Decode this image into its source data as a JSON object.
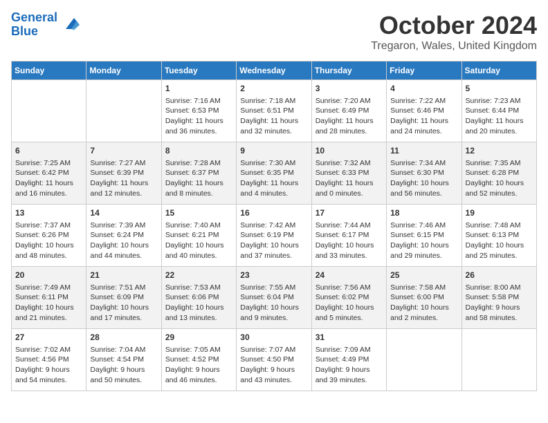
{
  "header": {
    "logo_line1": "General",
    "logo_line2": "Blue",
    "month_title": "October 2024",
    "location": "Tregaron, Wales, United Kingdom"
  },
  "days_of_week": [
    "Sunday",
    "Monday",
    "Tuesday",
    "Wednesday",
    "Thursday",
    "Friday",
    "Saturday"
  ],
  "weeks": [
    [
      {
        "day": "",
        "info": ""
      },
      {
        "day": "",
        "info": ""
      },
      {
        "day": "1",
        "info": "Sunrise: 7:16 AM\nSunset: 6:53 PM\nDaylight: 11 hours\nand 36 minutes."
      },
      {
        "day": "2",
        "info": "Sunrise: 7:18 AM\nSunset: 6:51 PM\nDaylight: 11 hours\nand 32 minutes."
      },
      {
        "day": "3",
        "info": "Sunrise: 7:20 AM\nSunset: 6:49 PM\nDaylight: 11 hours\nand 28 minutes."
      },
      {
        "day": "4",
        "info": "Sunrise: 7:22 AM\nSunset: 6:46 PM\nDaylight: 11 hours\nand 24 minutes."
      },
      {
        "day": "5",
        "info": "Sunrise: 7:23 AM\nSunset: 6:44 PM\nDaylight: 11 hours\nand 20 minutes."
      }
    ],
    [
      {
        "day": "6",
        "info": "Sunrise: 7:25 AM\nSunset: 6:42 PM\nDaylight: 11 hours\nand 16 minutes."
      },
      {
        "day": "7",
        "info": "Sunrise: 7:27 AM\nSunset: 6:39 PM\nDaylight: 11 hours\nand 12 minutes."
      },
      {
        "day": "8",
        "info": "Sunrise: 7:28 AM\nSunset: 6:37 PM\nDaylight: 11 hours\nand 8 minutes."
      },
      {
        "day": "9",
        "info": "Sunrise: 7:30 AM\nSunset: 6:35 PM\nDaylight: 11 hours\nand 4 minutes."
      },
      {
        "day": "10",
        "info": "Sunrise: 7:32 AM\nSunset: 6:33 PM\nDaylight: 11 hours\nand 0 minutes."
      },
      {
        "day": "11",
        "info": "Sunrise: 7:34 AM\nSunset: 6:30 PM\nDaylight: 10 hours\nand 56 minutes."
      },
      {
        "day": "12",
        "info": "Sunrise: 7:35 AM\nSunset: 6:28 PM\nDaylight: 10 hours\nand 52 minutes."
      }
    ],
    [
      {
        "day": "13",
        "info": "Sunrise: 7:37 AM\nSunset: 6:26 PM\nDaylight: 10 hours\nand 48 minutes."
      },
      {
        "day": "14",
        "info": "Sunrise: 7:39 AM\nSunset: 6:24 PM\nDaylight: 10 hours\nand 44 minutes."
      },
      {
        "day": "15",
        "info": "Sunrise: 7:40 AM\nSunset: 6:21 PM\nDaylight: 10 hours\nand 40 minutes."
      },
      {
        "day": "16",
        "info": "Sunrise: 7:42 AM\nSunset: 6:19 PM\nDaylight: 10 hours\nand 37 minutes."
      },
      {
        "day": "17",
        "info": "Sunrise: 7:44 AM\nSunset: 6:17 PM\nDaylight: 10 hours\nand 33 minutes."
      },
      {
        "day": "18",
        "info": "Sunrise: 7:46 AM\nSunset: 6:15 PM\nDaylight: 10 hours\nand 29 minutes."
      },
      {
        "day": "19",
        "info": "Sunrise: 7:48 AM\nSunset: 6:13 PM\nDaylight: 10 hours\nand 25 minutes."
      }
    ],
    [
      {
        "day": "20",
        "info": "Sunrise: 7:49 AM\nSunset: 6:11 PM\nDaylight: 10 hours\nand 21 minutes."
      },
      {
        "day": "21",
        "info": "Sunrise: 7:51 AM\nSunset: 6:09 PM\nDaylight: 10 hours\nand 17 minutes."
      },
      {
        "day": "22",
        "info": "Sunrise: 7:53 AM\nSunset: 6:06 PM\nDaylight: 10 hours\nand 13 minutes."
      },
      {
        "day": "23",
        "info": "Sunrise: 7:55 AM\nSunset: 6:04 PM\nDaylight: 10 hours\nand 9 minutes."
      },
      {
        "day": "24",
        "info": "Sunrise: 7:56 AM\nSunset: 6:02 PM\nDaylight: 10 hours\nand 5 minutes."
      },
      {
        "day": "25",
        "info": "Sunrise: 7:58 AM\nSunset: 6:00 PM\nDaylight: 10 hours\nand 2 minutes."
      },
      {
        "day": "26",
        "info": "Sunrise: 8:00 AM\nSunset: 5:58 PM\nDaylight: 9 hours\nand 58 minutes."
      }
    ],
    [
      {
        "day": "27",
        "info": "Sunrise: 7:02 AM\nSunset: 4:56 PM\nDaylight: 9 hours\nand 54 minutes."
      },
      {
        "day": "28",
        "info": "Sunrise: 7:04 AM\nSunset: 4:54 PM\nDaylight: 9 hours\nand 50 minutes."
      },
      {
        "day": "29",
        "info": "Sunrise: 7:05 AM\nSunset: 4:52 PM\nDaylight: 9 hours\nand 46 minutes."
      },
      {
        "day": "30",
        "info": "Sunrise: 7:07 AM\nSunset: 4:50 PM\nDaylight: 9 hours\nand 43 minutes."
      },
      {
        "day": "31",
        "info": "Sunrise: 7:09 AM\nSunset: 4:49 PM\nDaylight: 9 hours\nand 39 minutes."
      },
      {
        "day": "",
        "info": ""
      },
      {
        "day": "",
        "info": ""
      }
    ]
  ]
}
